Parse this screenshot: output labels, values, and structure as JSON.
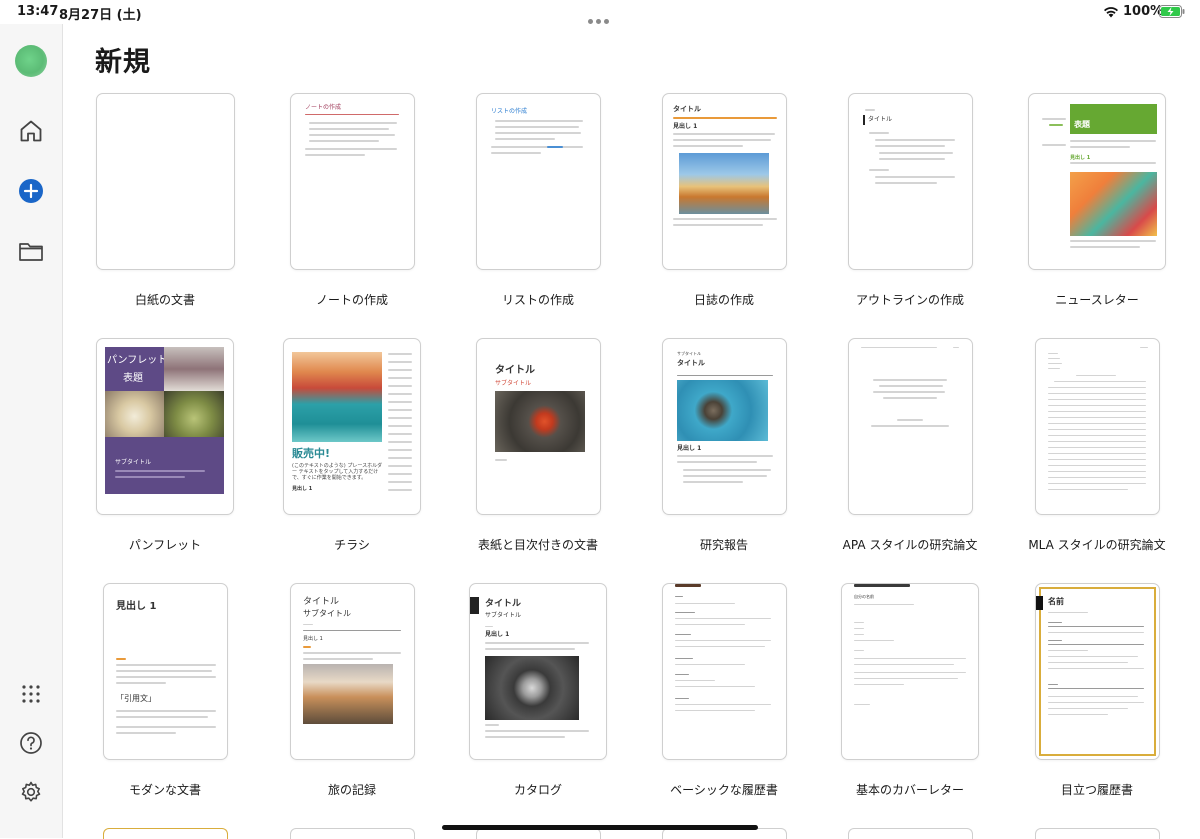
{
  "status_bar": {
    "time": "13:47",
    "date": "8月27日 (土)",
    "battery_percent": "100%",
    "battery_level": 1.0,
    "battery_color": "#30c94a"
  },
  "sidebar": {
    "items": [
      {
        "name": "avatar",
        "icon": "avatar"
      },
      {
        "name": "home",
        "icon": "home-icon"
      },
      {
        "name": "new",
        "icon": "plus-circle-icon",
        "color": "#1a66c8"
      },
      {
        "name": "open",
        "icon": "folder-icon"
      },
      {
        "name": "apps",
        "icon": "grid-dots-icon"
      },
      {
        "name": "help",
        "icon": "question-icon"
      },
      {
        "name": "settings",
        "icon": "gear-icon"
      }
    ]
  },
  "page": {
    "title": "新規"
  },
  "templates": [
    {
      "id": "blank",
      "caption": "白紙の文書"
    },
    {
      "id": "note",
      "caption": "ノートの作成",
      "heading": "ノートの作成"
    },
    {
      "id": "list",
      "caption": "リストの作成",
      "heading": "リストの作成"
    },
    {
      "id": "journal",
      "caption": "日誌の作成",
      "heading": "タイトル",
      "subheading": "見出し 1"
    },
    {
      "id": "outline",
      "caption": "アウトラインの作成",
      "heading": "タイトル"
    },
    {
      "id": "newsletter",
      "caption": "ニュースレター",
      "heading": "表題",
      "subheading": "見出し 1"
    },
    {
      "id": "pamphlet",
      "caption": "パンフレット",
      "heading_line1": "パンフレットの",
      "heading_line2": "表題",
      "subheading": "サブタイトル"
    },
    {
      "id": "flyer",
      "caption": "チラシ",
      "heading": "販売中!",
      "body": "(このテキストのような) プレースホルダー テキストをタップして入力するだけで、すぐに作業を開始できます。",
      "subheading": "見出し 1"
    },
    {
      "id": "cover-toc",
      "caption": "表紙と目次付きの文書",
      "heading": "タイトル",
      "subheading": "サブタイトル"
    },
    {
      "id": "research",
      "caption": "研究報告",
      "eyebrow": "サブタイトル",
      "heading": "タイトル",
      "subheading": "見出し 1"
    },
    {
      "id": "apa",
      "caption": "APA スタイルの研究論文"
    },
    {
      "id": "mla",
      "caption": "MLA スタイルの研究論文"
    },
    {
      "id": "modern",
      "caption": "モダンな文書",
      "heading": "見出し 1",
      "quote": "「引用文」"
    },
    {
      "id": "travel",
      "caption": "旅の記録",
      "heading": "タイトル",
      "subheading": "サブタイトル",
      "section": "見出し 1"
    },
    {
      "id": "catalog",
      "caption": "カタログ",
      "heading": "タイトル",
      "subheading": "サブタイトル",
      "section": "見出し 1"
    },
    {
      "id": "basic-resume",
      "caption": "ベーシックな履歴書",
      "heading": "名前"
    },
    {
      "id": "cover-letter",
      "caption": "基本のカバーレター",
      "heading": "自分の名前"
    },
    {
      "id": "stand-out-resume",
      "caption": "目立つ履歴書",
      "heading": "名前"
    }
  ],
  "colors": {
    "accent": "#1a66c8",
    "pamphlet_purple": "#5e4a86",
    "newsletter_green": "#66a832",
    "resume_gold": "#d9ad3c"
  }
}
